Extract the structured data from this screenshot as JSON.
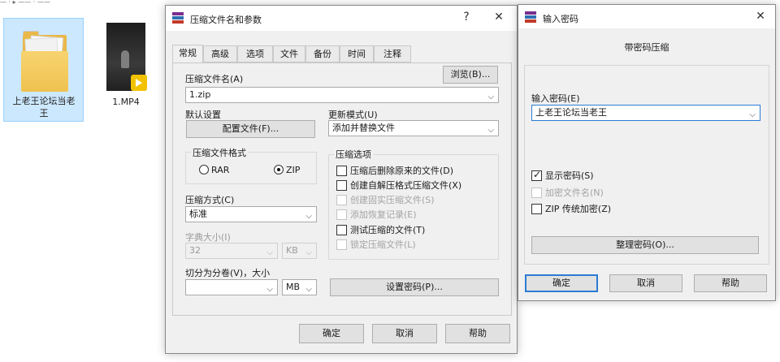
{
  "explorer": {
    "breadcrumb": "— · ▸ —— · ——",
    "items": [
      {
        "name": "上老王论坛当老王",
        "type": "folder",
        "selected": true
      },
      {
        "name": "1.MP4",
        "type": "video",
        "selected": false
      }
    ]
  },
  "archive_dialog": {
    "title": "压缩文件名和参数",
    "help_btn": "?",
    "close_btn": "✕",
    "tabs": [
      "常规",
      "高级",
      "选项",
      "文件",
      "备份",
      "时间",
      "注释"
    ],
    "active_tab": "常规",
    "archive_name_label": "压缩文件名(A)",
    "browse_btn": "浏览(B)...",
    "archive_name_value": "1.zip",
    "default_settings_label": "默认设置",
    "profiles_btn": "配置文件(F)...",
    "update_mode_label": "更新模式(U)",
    "update_mode_value": "添加并替换文件",
    "format_group": "压缩文件格式",
    "format_rar": "RAR",
    "format_zip": "ZIP",
    "options_group": "压缩选项",
    "options": [
      {
        "label": "压缩后删除原来的文件(D)",
        "checked": false,
        "enabled": true
      },
      {
        "label": "创建自解压格式压缩文件(X)",
        "checked": false,
        "enabled": true
      },
      {
        "label": "创建固实压缩文件(S)",
        "checked": false,
        "enabled": false
      },
      {
        "label": "添加恢复记录(E)",
        "checked": false,
        "enabled": false
      },
      {
        "label": "测试压缩的文件(T)",
        "checked": false,
        "enabled": true
      },
      {
        "label": "锁定压缩文件(L)",
        "checked": false,
        "enabled": false
      }
    ],
    "method_label": "压缩方式(C)",
    "method_value": "标准",
    "dict_label": "字典大小(I)",
    "dict_value": "32",
    "dict_unit": "KB",
    "split_label": "切分为分卷(V)，大小",
    "split_value": "",
    "split_unit": "MB",
    "set_password_btn": "设置密码(P)...",
    "ok_btn": "确定",
    "cancel_btn": "取消",
    "help_footer_btn": "帮助"
  },
  "password_dialog": {
    "title": "输入密码",
    "close_btn": "✕",
    "heading": "带密码压缩",
    "password_label": "输入密码(E)",
    "password_value": "上老王论坛当老王",
    "show_password": {
      "label": "显示密码(S)",
      "checked": true
    },
    "encrypt_names": {
      "label": "加密文件名(N)",
      "checked": false
    },
    "zip_legacy": {
      "label": "ZIP 传统加密(Z)",
      "checked": false
    },
    "organize_btn": "整理密码(O)...",
    "ok_btn": "确定",
    "cancel_btn": "取消",
    "help_btn": "帮助"
  }
}
